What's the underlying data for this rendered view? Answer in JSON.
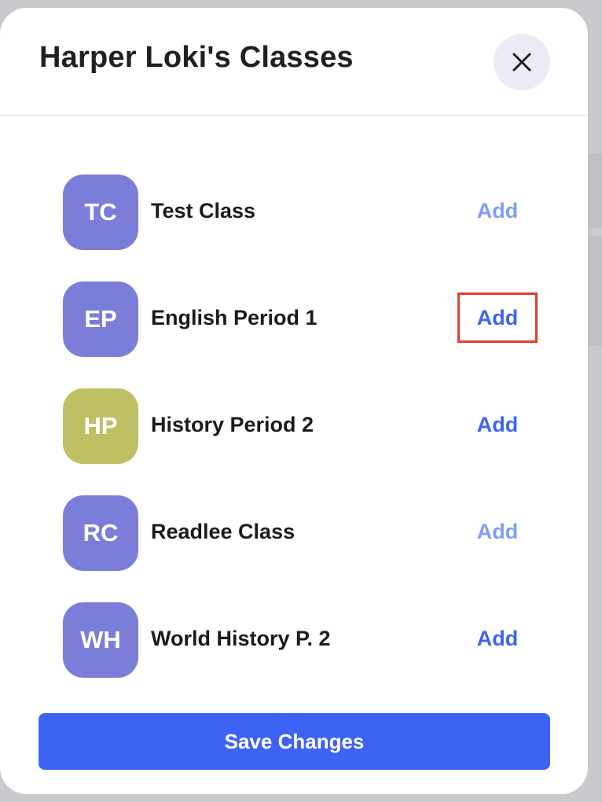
{
  "modal": {
    "title": "Harper Loki's Classes",
    "close_icon": "close-icon"
  },
  "classes": [
    {
      "initials": "TC",
      "name": "Test Class",
      "action_label": "Add",
      "avatar_color": "#7b7ed8",
      "action_color": "#7fa0f3",
      "highlighted": false
    },
    {
      "initials": "EP",
      "name": "English Period 1",
      "action_label": "Add",
      "avatar_color": "#7b7ed8",
      "action_color": "#3d63f0",
      "highlighted": true
    },
    {
      "initials": "HP",
      "name": "History Period 2",
      "action_label": "Add",
      "avatar_color": "#bfc063",
      "action_color": "#3d63f0",
      "highlighted": false
    },
    {
      "initials": "RC",
      "name": "Readlee Class",
      "action_label": "Add",
      "avatar_color": "#7b7ed8",
      "action_color": "#7fa0f3",
      "highlighted": false
    },
    {
      "initials": "WH",
      "name": "World History P. 2",
      "action_label": "Add",
      "avatar_color": "#7b7ed8",
      "action_color": "#3d63f0",
      "highlighted": false
    }
  ],
  "footer": {
    "save_label": "Save Changes"
  },
  "colors": {
    "primary": "#3d63f5",
    "highlight_border": "#e03e2d",
    "backdrop": "#c9cacd"
  }
}
